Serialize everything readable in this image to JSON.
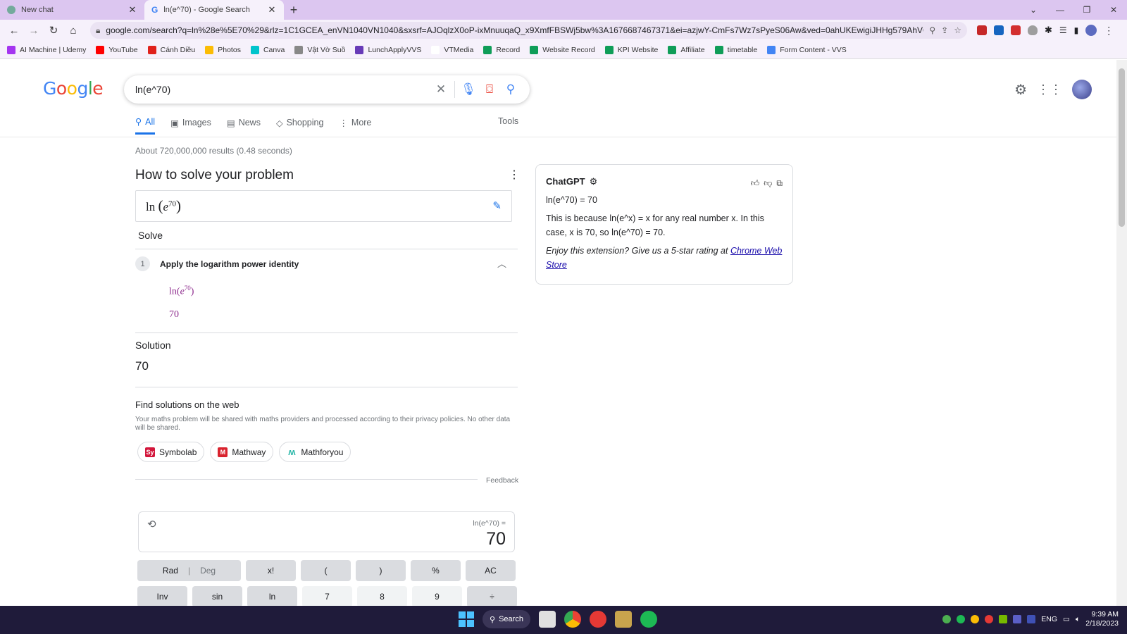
{
  "browser": {
    "tabs": [
      {
        "title": "New chat",
        "active": false
      },
      {
        "title": "ln(e^70) - Google Search",
        "active": true
      }
    ],
    "url": "google.com/search?q=ln%28e%5E70%29&rlz=1C1GCEA_enVN1040VN1040&sxsrf=AJOqlzX0oP-ixMnuuqaQ_x9XmfFBSWj5bw%3A1676687467371&ei=azjwY-CmFs7Wz7sPyeS06Aw&ved=0ahUKEwigiJHHg579AhVO6...",
    "bookmarks": [
      {
        "label": "AI Machine | Udemy",
        "color": "#a435f0"
      },
      {
        "label": "YouTube",
        "color": "#ff0000"
      },
      {
        "label": "Cánh Diều",
        "color": "#e0211b"
      },
      {
        "label": "Photos",
        "color": "#fbbc04"
      },
      {
        "label": "Canva",
        "color": "#00c4cc"
      },
      {
        "label": "Vật Vờ Suồ",
        "color": "#888888"
      },
      {
        "label": "LunchApplyVVS",
        "color": "#673ab7"
      },
      {
        "label": "VTMedia",
        "color": "#ffffff"
      },
      {
        "label": "Record",
        "color": "#0f9d58"
      },
      {
        "label": "Website Record",
        "color": "#0f9d58"
      },
      {
        "label": "KPI Website",
        "color": "#0f9d58"
      },
      {
        "label": "Affiliate",
        "color": "#0f9d58"
      },
      {
        "label": "timetable",
        "color": "#0f9d58"
      },
      {
        "label": "Form Content - VVS",
        "color": "#4285f4"
      }
    ]
  },
  "google": {
    "logo": "Google",
    "query": "ln(e^70)",
    "nav": [
      {
        "label": "All",
        "icon": "search-icon"
      },
      {
        "label": "Images",
        "icon": "image-icon"
      },
      {
        "label": "News",
        "icon": "news-icon"
      },
      {
        "label": "Shopping",
        "icon": "tag-icon"
      },
      {
        "label": "More",
        "icon": "kebab-icon"
      }
    ],
    "tools": "Tools",
    "stats": "About 720,000,000 results (0.48 seconds)"
  },
  "solver": {
    "heading": "How to solve your problem",
    "problem": "ln(e^70)",
    "solve_label": "Solve",
    "step_number": "1",
    "step_title": "Apply the logarithm power identity",
    "step_expr": "ln(e^70)",
    "step_result": "70",
    "solution_label": "Solution",
    "solution_value": "70",
    "find_label": "Find solutions on the web",
    "disclaimer": "Your maths problem will be shared with maths providers and processed according to their privacy policies. No other data will be shared.",
    "providers": [
      {
        "label": "Symbolab",
        "badge": "Sy",
        "color": "#d3163b"
      },
      {
        "label": "Mathway",
        "badge": "M",
        "color": "#d9232e"
      },
      {
        "label": "Mathforyou",
        "badge": "M",
        "color": "#2ab7a9"
      }
    ],
    "feedback": "Feedback"
  },
  "calculator": {
    "expression": "ln(e^70) =",
    "result": "70",
    "row1": [
      "Rad",
      "Deg",
      "x!",
      "(",
      ")",
      "%",
      "AC"
    ],
    "row2": [
      "Inv",
      "sin",
      "ln",
      "7",
      "8",
      "9",
      "÷"
    ]
  },
  "chatgpt": {
    "title": "ChatGPT",
    "line1": "ln(e^70) = 70",
    "line2": "This is because ln(e^x) = x for any real number x. In this case, x is 70, so ln(e^70) = 70.",
    "rating_text": "Enjoy this extension? Give us a 5-star rating at ",
    "rating_link": "Chrome Web Store"
  },
  "taskbar": {
    "search": "Search",
    "lang": "ENG",
    "time": "9:39 AM",
    "date": "2/18/2023"
  }
}
